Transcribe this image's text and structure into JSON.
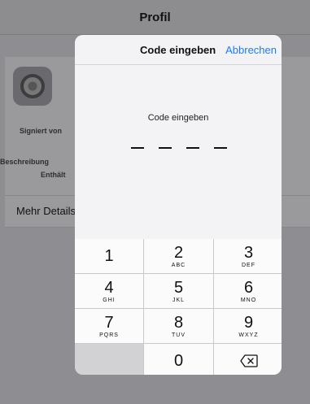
{
  "background": {
    "nav_title": "Profil",
    "labels": {
      "signed_by": "Signiert von",
      "description": "Beschreibung",
      "contains": "Enthält"
    },
    "more_details": "Mehr Details"
  },
  "modal": {
    "title": "Code eingeben",
    "cancel": "Abbrechen",
    "prompt": "Code eingeben",
    "code_length": 4
  },
  "keypad": {
    "keys": [
      {
        "digit": "1",
        "letters": ""
      },
      {
        "digit": "2",
        "letters": "ABC"
      },
      {
        "digit": "3",
        "letters": "DEF"
      },
      {
        "digit": "4",
        "letters": "GHI"
      },
      {
        "digit": "5",
        "letters": "JKL"
      },
      {
        "digit": "6",
        "letters": "MNO"
      },
      {
        "digit": "7",
        "letters": "PQRS"
      },
      {
        "digit": "8",
        "letters": "TUV"
      },
      {
        "digit": "9",
        "letters": "WXYZ"
      },
      {
        "digit": "",
        "letters": ""
      },
      {
        "digit": "0",
        "letters": ""
      },
      {
        "digit": "",
        "letters": "",
        "icon": "backspace-icon"
      }
    ]
  },
  "colors": {
    "accent": "#1e7cf4",
    "dim_background": "#8e8e92",
    "modal_background": "#f3f3f5",
    "key_background": "#fbfbfc"
  }
}
